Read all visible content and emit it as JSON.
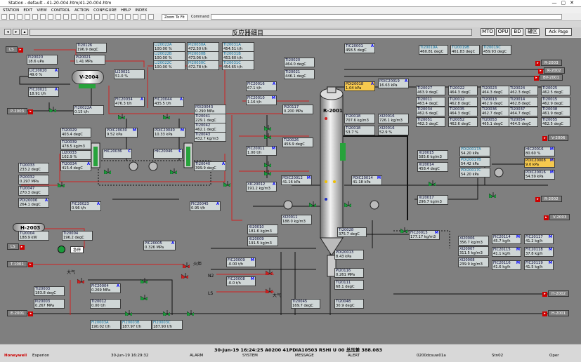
{
  "window": {
    "title": "Station - default - 41-20-004.htm/41-20-004.htm"
  },
  "menu": [
    "STATION",
    "EDIT",
    "VIEW",
    "CONTROL",
    "ACTION",
    "CONFIGURE",
    "HELP",
    "INDEX"
  ],
  "toolbar": {
    "zoom": "Zoom To Fit",
    "command_label": "Command"
  },
  "header": {
    "title": "反应器细目",
    "btn_mto": "MTO",
    "btn_opu": "OPU",
    "btn_bd": "BD",
    "btn_area": "罐区",
    "btn_ack": "Ack Page"
  },
  "equipment": {
    "v2004": "V-2004",
    "r2001": "R-2001",
    "h2003": "H-2003",
    "lamp": "急停"
  },
  "tags": [
    {
      "id": "TI20126",
      "n": "TI20126",
      "v": "196.9 degC"
    },
    {
      "id": "PI20020",
      "n": "PI20020",
      "v": "18.6 uPa"
    },
    {
      "id": "PI20021",
      "n": "PI20021",
      "v": "1.41 MPa"
    },
    {
      "id": "LIC20020",
      "n": "LIC20020",
      "v": "49.0 %",
      "m": "A"
    },
    {
      "id": "LI20021",
      "n": "LI20021",
      "v": "51.0 %"
    },
    {
      "id": "TI20022",
      "n": "TI20022",
      "v": "928.89 t/h"
    },
    {
      "id": "FIC20021",
      "n": "FIC20021",
      "v": "18.91 t/h",
      "m": "A"
    },
    {
      "id": "FI20022A",
      "n": "FI20022A",
      "v": "0.15 t/h"
    },
    {
      "id": "LI20022A",
      "n": "LI20022A",
      "v": "100.00 %"
    },
    {
      "id": "LI20022B",
      "n": "LI20022B",
      "v": "100.00 %"
    },
    {
      "id": "LI20022C",
      "n": "LI20022C",
      "v": "100.00 %"
    },
    {
      "id": "PI20030A",
      "n": "PI20030A",
      "v": "472.50 t/h"
    },
    {
      "id": "PI20030B",
      "n": "PI20030B",
      "v": "473.06 t/h"
    },
    {
      "id": "PI20030C",
      "n": "PI20030C",
      "v": "472.78 t/h"
    },
    {
      "id": "TI20031A",
      "n": "TI20031A",
      "v": "454.51 t/h"
    },
    {
      "id": "TI20031B",
      "n": "TI20031B",
      "v": "453.60 t/h"
    },
    {
      "id": "TI20031C",
      "n": "TI20031C",
      "v": "454.65 t/h"
    },
    {
      "id": "FIC20034",
      "n": "FIC20034",
      "v": "476.3 t/h",
      "m": "A"
    },
    {
      "id": "FIC20044",
      "n": "FIC20044",
      "v": "435.5 t/h",
      "m": "A"
    },
    {
      "id": "PDI20043",
      "n": "PDI20043",
      "v": "0.290 MPa"
    },
    {
      "id": "TI20029",
      "n": "TI20029",
      "v": "403.4 degC"
    },
    {
      "id": "PDIC20030",
      "n": "PDIC20030",
      "v": "9.52 kPa",
      "m": "M"
    },
    {
      "id": "PDIC20040",
      "n": "PDIC20040",
      "v": "10.33 kPa",
      "m": "M"
    },
    {
      "id": "TI20041",
      "n": "TI20041",
      "v": "229.1 degC"
    },
    {
      "id": "TI20039",
      "n": "TI20039",
      "v": "478.5 kg/m3"
    },
    {
      "id": "TI20042",
      "n": "TI20042",
      "v": "462.1 degC"
    },
    {
      "id": "TI20043",
      "n": "TI20043",
      "v": "432.7 kg/m3"
    },
    {
      "id": "LI20033",
      "n": "LI20033",
      "v": "102.9 %"
    },
    {
      "id": "HIC20036",
      "n": "HIC20036",
      "v": "",
      "m": "C"
    },
    {
      "id": "HIC20046",
      "n": "HIC20046",
      "v": "",
      "m": "C"
    },
    {
      "id": "TI20033",
      "n": "TI20033",
      "v": "233.2 degC"
    },
    {
      "id": "TI20034",
      "n": "TI20034",
      "v": "415.4 degC",
      "m": "A"
    },
    {
      "id": "TI20040",
      "n": "TI20040",
      "v": "399.9 degC",
      "m": "A"
    },
    {
      "id": "PI20032",
      "n": "PI20032",
      "v": "0.297 MPa"
    },
    {
      "id": "TI20047",
      "n": "TI20047",
      "v": "270.3 degC"
    },
    {
      "id": "PDI20006",
      "n": "PDI20006",
      "v": "264.1 degC",
      "m": "A"
    },
    {
      "id": "FIC20023",
      "n": "FIC20023",
      "v": "0.96 t/h",
      "m": "A"
    },
    {
      "id": "FIC20045",
      "n": "FIC20045",
      "v": "0.95 t/h",
      "m": "A"
    },
    {
      "id": "TI20004",
      "n": "TI20004",
      "v": "188.9 kW"
    },
    {
      "id": "TI20004b",
      "n": "TI20004",
      "v": "196.2 degC"
    },
    {
      "id": "TIC20001",
      "n": "TIC20001",
      "v": "458.5 degC",
      "m": "A"
    },
    {
      "id": "TI20020",
      "n": "TI20020",
      "v": "464.0 degC"
    },
    {
      "id": "TI20021",
      "n": "TI20021",
      "v": "446.1 degC"
    },
    {
      "id": "PDI20018",
      "n": "PDI20018",
      "v": "1.04 kPa",
      "m": "A"
    },
    {
      "id": "PDIC20019",
      "n": "PDIC20019",
      "v": "16.63 kPa",
      "m": "A"
    },
    {
      "id": "FIC20016",
      "n": "FIC20016",
      "v": "67.1 t/h",
      "m": "A"
    },
    {
      "id": "FIC20010",
      "n": "FIC20010",
      "v": "1.16 t/h",
      "m": "M"
    },
    {
      "id": "FIC20011",
      "n": "FIC20011",
      "v": "1.00 t/h",
      "m": "M"
    },
    {
      "id": "PI20117",
      "n": "PI20117",
      "v": "0.200 MPa"
    },
    {
      "id": "TI20026",
      "n": "TI20026",
      "v": "456.9 degC"
    },
    {
      "id": "TI20018",
      "n": "TI20018",
      "v": "707.6 kg/m3"
    },
    {
      "id": "TI20018b",
      "n": "TI20018",
      "v": "53.7 %"
    },
    {
      "id": "XI20016",
      "n": "XI20016",
      "v": "726.1 kg/m3"
    },
    {
      "id": "XI20016b",
      "n": "XI20016",
      "v": "52.9 %"
    },
    {
      "id": "TI20019A",
      "n": "TI20019A",
      "v": "460.81 degC"
    },
    {
      "id": "TI20019B",
      "n": "TI20019B",
      "v": "461.83 degC"
    },
    {
      "id": "TI20019C",
      "n": "TI20019C",
      "v": "459.93 degC"
    },
    {
      "id": "TI20027",
      "n": "TI20027",
      "v": "463.9 degC"
    },
    {
      "id": "TI20022",
      "n": "TI20022",
      "v": "464.3 degC"
    },
    {
      "id": "TI20023",
      "n": "TI20023",
      "v": "464.3 degC"
    },
    {
      "id": "TI20024",
      "n": "TI20024",
      "v": "462.3 degC"
    },
    {
      "id": "TI20025",
      "n": "TI20025",
      "v": "462.5 degC"
    },
    {
      "id": "TI20011",
      "n": "TI20011",
      "v": "463.4 degC"
    },
    {
      "id": "TI20012",
      "n": "TI20012",
      "v": "462.8 degC"
    },
    {
      "id": "TI20013",
      "n": "TI20013",
      "v": "462.9 degC"
    },
    {
      "id": "TI20014",
      "n": "TI20014",
      "v": "462.8 degC"
    },
    {
      "id": "TI20015",
      "n": "TI20015",
      "v": "462.9 degC"
    },
    {
      "id": "TI20034b",
      "n": "TI20034",
      "v": "462.6 degC"
    },
    {
      "id": "TI20035",
      "n": "TI20035",
      "v": "464.3 degC"
    },
    {
      "id": "TI20036",
      "n": "TI20036",
      "v": "462.7 degC"
    },
    {
      "id": "TI20037",
      "n": "TI20037",
      "v": "464.7 degC"
    },
    {
      "id": "TI20038",
      "n": "TI20038",
      "v": "461.9 degC"
    },
    {
      "id": "TI20051",
      "n": "TI20051",
      "v": "462.3 degC"
    },
    {
      "id": "TI20052",
      "n": "TI20052",
      "v": "462.6 degC"
    },
    {
      "id": "TI20053",
      "n": "TI20053",
      "v": "465.1 degC"
    },
    {
      "id": "TI20054",
      "n": "TI20054",
      "v": "464.5 degC"
    },
    {
      "id": "TI20055",
      "n": "TI20055",
      "v": "462.5 degC"
    },
    {
      "id": "XIC20012",
      "n": "XIC20012",
      "v": "191.2 kg/m3",
      "m": "A"
    },
    {
      "id": "PDIC20012",
      "n": "PDIC20012",
      "v": "41.16 kPa",
      "m": "M"
    },
    {
      "id": "PDIC20014",
      "n": "PDIC20014",
      "v": "41.18 kPa",
      "m": "M"
    },
    {
      "id": "XI20011",
      "n": "XI20011",
      "v": "188.0 kg/m3"
    },
    {
      "id": "XI20010",
      "n": "XI20010",
      "v": "181.6 kg/m3"
    },
    {
      "id": "XI20009",
      "n": "XI20009",
      "v": "191.5 kg/m3"
    },
    {
      "id": "TI20028",
      "n": "TI20028",
      "v": "375.7 degC"
    },
    {
      "id": "PDI20013",
      "n": "PDI20013",
      "v": "8.43 kPa"
    },
    {
      "id": "PI20116",
      "n": "PI20116",
      "v": "0.261 MPa"
    },
    {
      "id": "TI20111",
      "n": "TI20111",
      "v": "68.1 degC"
    },
    {
      "id": "TI20045",
      "n": "TI20045",
      "v": "169.7 degC"
    },
    {
      "id": "TI20048",
      "n": "TI20048",
      "v": "30.9 degC"
    },
    {
      "id": "FIC20015",
      "n": "FIC20015",
      "v": "177.17 kg/m3",
      "m": "M"
    },
    {
      "id": "XI20017",
      "n": "XI20017",
      "v": "296.7 kg/m3"
    },
    {
      "id": "XI20015",
      "n": "XI20015",
      "v": "585.6 kg/m3"
    },
    {
      "id": "XI20014",
      "n": "XI20014",
      "v": "458.4 degC"
    },
    {
      "id": "PDI20017A",
      "n": "PDI20017A",
      "v": "54.20 kPa"
    },
    {
      "id": "PDI20017B",
      "n": "PDI20017B",
      "v": "54.42 kPa"
    },
    {
      "id": "PDI20017C",
      "n": "PDI20017C",
      "v": "54.20 kPa"
    },
    {
      "id": "HIC20016",
      "n": "HIC20016",
      "v": "80.60 %",
      "m": "M"
    },
    {
      "id": "PDIC20008",
      "n": "PDIC20008",
      "v": "9.0 kPa",
      "m": "M"
    },
    {
      "id": "PDIC20016",
      "n": "PDIC20016",
      "v": "54.59 kPa",
      "m": "M"
    },
    {
      "id": "XI20006",
      "n": "XI20006",
      "v": "356.7 kg/m3"
    },
    {
      "id": "XI20007",
      "n": "XI20007",
      "v": "311.5 kg/m3"
    },
    {
      "id": "XI20008",
      "n": "XI20008",
      "v": "239.9 kg/m3"
    },
    {
      "id": "FIC20114",
      "n": "FIC20114",
      "v": "45.7 kg/h",
      "m": "M"
    },
    {
      "id": "FIC20117",
      "n": "FIC20117",
      "v": "41.2 kg/h",
      "m": "M"
    },
    {
      "id": "FIC20115",
      "n": "FIC20115",
      "v": "41.1 kg/h",
      "m": "M"
    },
    {
      "id": "FIC20118",
      "n": "FIC20118",
      "v": "37.8 kg/h",
      "m": "M"
    },
    {
      "id": "FIC20116",
      "n": "FIC20116",
      "v": "41.6 kg/h",
      "m": "M"
    },
    {
      "id": "FIC20119",
      "n": "FIC20119",
      "v": "41.5 kg/h",
      "m": "M"
    },
    {
      "id": "PIC20005",
      "n": "PIC20005",
      "v": "0.326 MPa",
      "m": "A"
    },
    {
      "id": "FIC20009",
      "n": "FIC20009",
      "v": "-0.00 t/h",
      "m": "M"
    },
    {
      "id": "FIC20008",
      "n": "FIC20008",
      "v": "-0.0 t/h",
      "m": "M"
    },
    {
      "id": "FIC20004",
      "n": "FIC20004",
      "v": "0.269 MPa",
      "m": "A"
    },
    {
      "id": "TI20012b",
      "n": "TI20012",
      "v": "0.00 t/h"
    },
    {
      "id": "TI20003",
      "n": "TI20003",
      "v": "183.8 degC"
    },
    {
      "id": "PI20003",
      "n": "PI20003",
      "v": "0.267 MPa"
    },
    {
      "id": "FI20003A",
      "n": "FI20003A",
      "v": "190.02 t/h"
    },
    {
      "id": "FI20003B",
      "n": "FI20003B",
      "v": "187.97 t/h"
    },
    {
      "id": "FI20003C",
      "n": "FI20003C",
      "v": "187.90 t/h"
    }
  ],
  "connectors": [
    {
      "id": "ls1",
      "label": "LS"
    },
    {
      "id": "p2003",
      "label": "P-2003"
    },
    {
      "id": "ls2",
      "label": "LS"
    },
    {
      "id": "t1001",
      "label": "T-1001"
    },
    {
      "id": "e2001",
      "label": "E-2001"
    },
    {
      "id": "r2003",
      "label": "R-2003"
    },
    {
      "id": "r2002",
      "label": "R-2002"
    },
    {
      "id": "bv2001",
      "label": "BV-2001"
    },
    {
      "id": "v2006",
      "label": "V-2006"
    },
    {
      "id": "r2002b",
      "label": "R-2002"
    },
    {
      "id": "v2003",
      "label": "V-2003"
    },
    {
      "id": "h2002",
      "label": "H-2002"
    },
    {
      "id": "h2001",
      "label": "H-2001"
    }
  ],
  "labels": {
    "n2": "N2",
    "ls": "LS",
    "fire1": "大气",
    "fire2": "火炬",
    "fire3": "大气"
  },
  "status": {
    "line": "30-Jun-19  16:24:25  A0200   41PDIA10503  RSHI  U 00 总压差   388.083",
    "brand": "Honeywell",
    "product": "Experion",
    "date": "30-Jun-19  16:29:32",
    "alarm": "ALARM",
    "system": "SYSTEM",
    "message": "MESSAGE",
    "alert": "ALERT",
    "station": "0200dcsuw01a",
    "stn": "Stn02",
    "oper": "Oper"
  },
  "colors": {
    "pipe_red": "#d02020",
    "pipe_black": "#111111",
    "valve_green": "#1a9a3a",
    "vessel_green": "#27a33b",
    "background": "#7f7f7f"
  }
}
